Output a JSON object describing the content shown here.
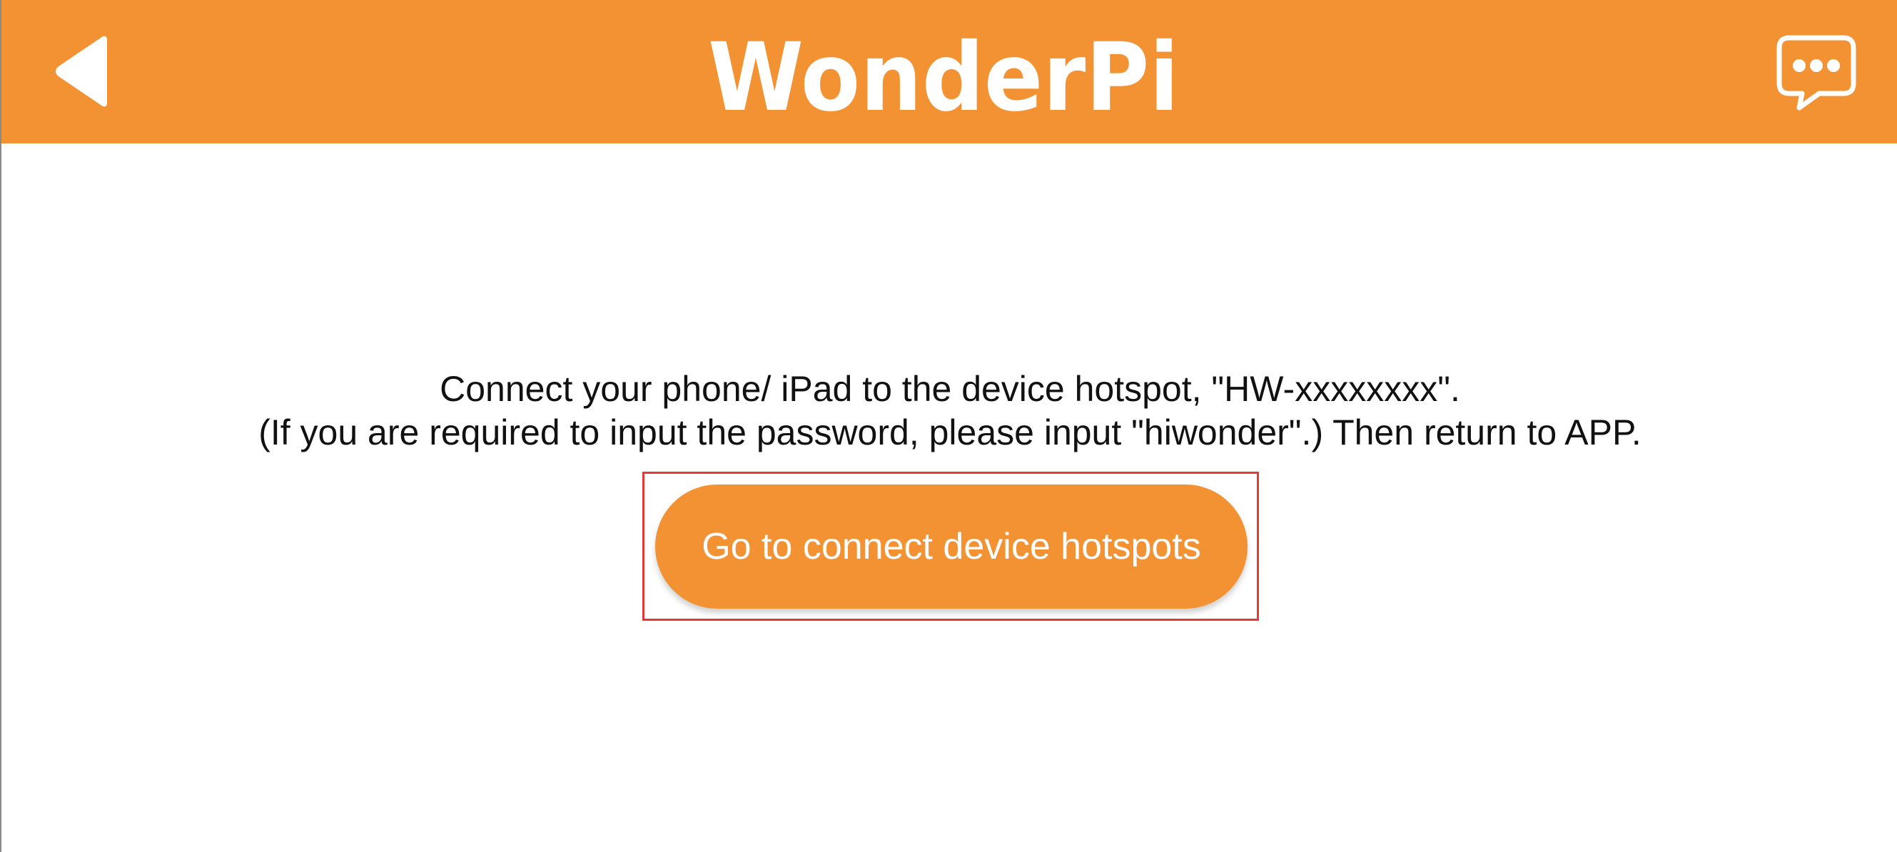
{
  "header": {
    "back_icon": "back-triangle-icon",
    "logo_text": "WonderPi",
    "chat_icon": "chat-bubble-icon"
  },
  "main": {
    "instruction_line_1": "Connect your phone/ iPad to the device hotspot, \"HW-xxxxxxxx\".",
    "instruction_line_2": "(If you are required to input the password, please input \"hiwonder\".) Then return to APP.",
    "connect_button_label": "Go to connect device hotspots"
  },
  "colors": {
    "accent": "#F39232",
    "highlight": "#E53935",
    "text": "#111111"
  }
}
